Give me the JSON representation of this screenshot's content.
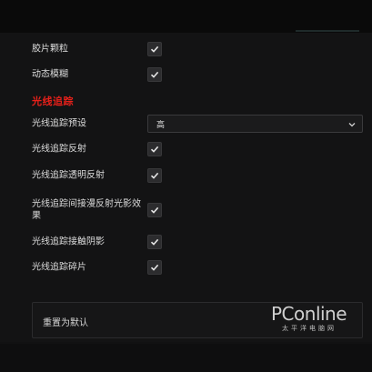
{
  "settings": {
    "film_grain": {
      "label": "胶片颗粒",
      "checked": true
    },
    "motion_blur": {
      "label": "动态模糊",
      "checked": true
    }
  },
  "raytracing": {
    "section_title": "光线追踪",
    "preset": {
      "label": "光线追踪预设",
      "value": "高"
    },
    "reflections": {
      "label": "光线追踪反射",
      "checked": true
    },
    "transparent_reflections": {
      "label": "光线追踪透明反射",
      "checked": true
    },
    "indirect_diffuse": {
      "label": "光线追踪间接漫反射光影效果",
      "checked": true
    },
    "contact_shadows": {
      "label": "光线追踪接触阴影",
      "checked": true
    },
    "debris": {
      "label": "光线追踪碎片",
      "checked": true
    }
  },
  "footer": {
    "reset_label": "重置为默认"
  },
  "watermark": {
    "logo": "PConline",
    "sub": "太平洋电脑网"
  },
  "colors": {
    "accent": "#e8201a",
    "background": "#131314"
  }
}
